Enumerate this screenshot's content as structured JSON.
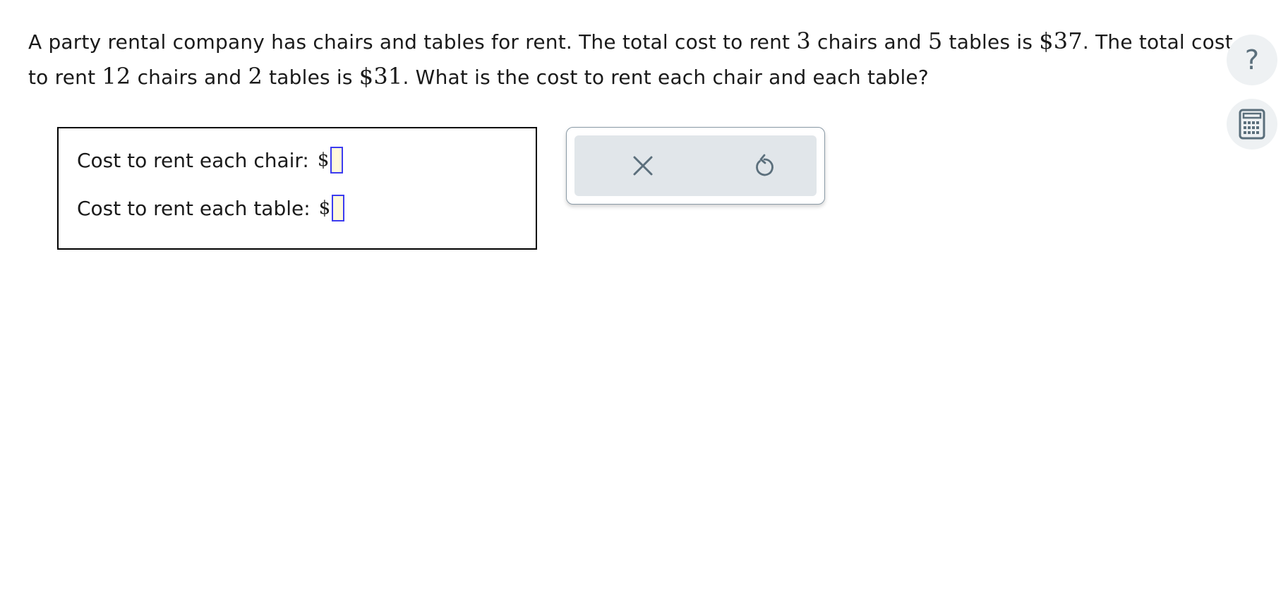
{
  "question": {
    "p1": "A party rental company has chairs and tables for rent. The total cost to rent ",
    "n1": "3",
    "p2": " chairs and ",
    "n2": "5",
    "p3": " tables is ",
    "n3": "$37",
    "p4": ". The total cost to rent ",
    "n4": "12",
    "p5": " chairs and ",
    "n5": "2",
    "p6": " tables is ",
    "n6": "$31",
    "p7": ". What is the cost to rent each chair and each table?"
  },
  "answers": {
    "chair_label": "Cost to rent each chair:",
    "chair_currency": "$",
    "chair_value": "",
    "table_label": "Cost to rent each table:",
    "table_currency": "$",
    "table_value": ""
  },
  "actions": {
    "clear_icon": "close-icon",
    "undo_icon": "undo-icon"
  },
  "side_tools": {
    "help_glyph": "?",
    "help_icon": "help-icon",
    "calculator_icon": "calculator-icon"
  },
  "colors": {
    "input_border": "#3c3cf0",
    "input_fill": "#fff9dc",
    "icon": "#5b6f7c",
    "panel_fill": "#e1e6ea"
  }
}
